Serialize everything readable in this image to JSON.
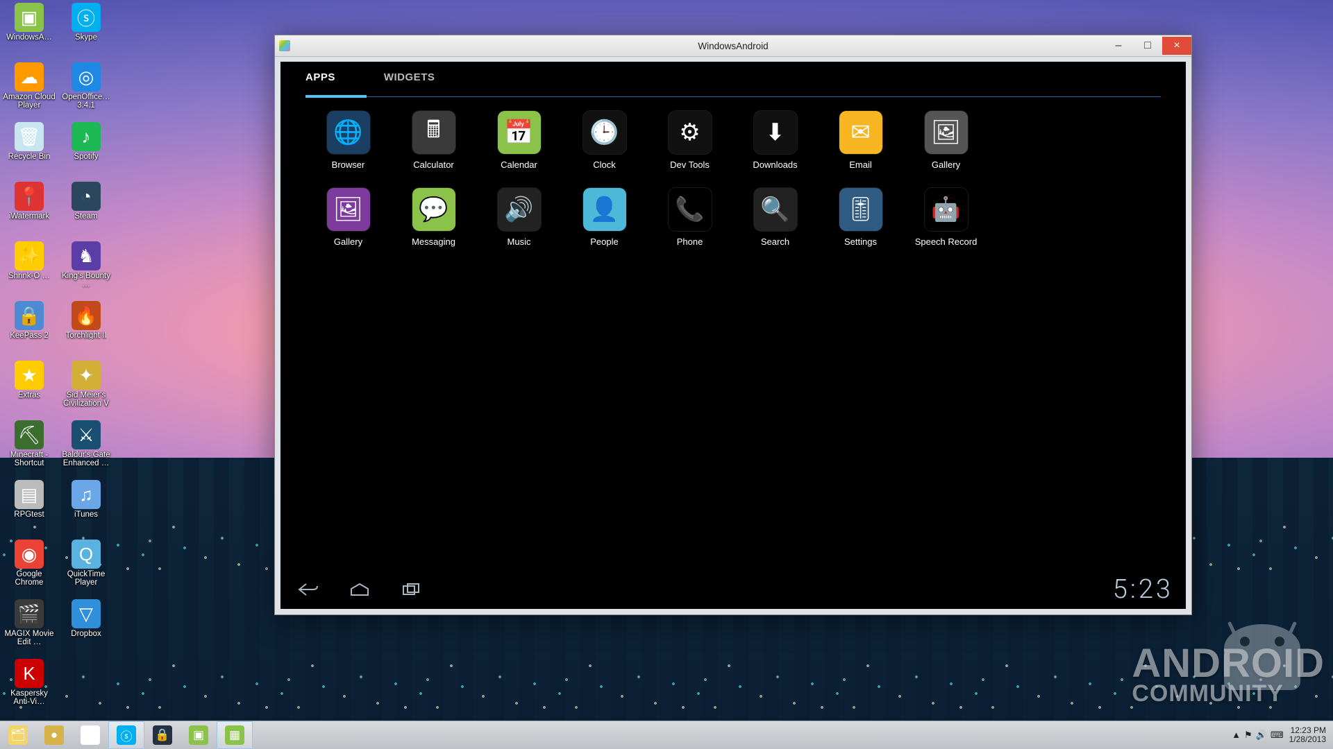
{
  "window": {
    "title": "WindowsAndroid",
    "minimize": "–",
    "maximize": "□",
    "close": "×"
  },
  "tabs": {
    "apps": "APPS",
    "widgets": "WIDGETS"
  },
  "apps": [
    {
      "label": "Browser",
      "icon": "browser-icon",
      "ibg": "#1b3f63",
      "glyph": "🌐"
    },
    {
      "label": "Calculator",
      "icon": "calculator-icon",
      "ibg": "#3a3a3a",
      "glyph": "🖩"
    },
    {
      "label": "Calendar",
      "icon": "calendar-icon",
      "ibg": "#8bc34a",
      "glyph": "📅"
    },
    {
      "label": "Clock",
      "icon": "clock-icon",
      "ibg": "#111",
      "glyph": "🕒"
    },
    {
      "label": "Dev Tools",
      "icon": "devtools-icon",
      "ibg": "#111",
      "glyph": "⚙"
    },
    {
      "label": "Downloads",
      "icon": "downloads-icon",
      "ibg": "#111",
      "glyph": "⬇"
    },
    {
      "label": "Email",
      "icon": "email-icon",
      "ibg": "#f7b521",
      "glyph": "✉"
    },
    {
      "label": "Gallery",
      "icon": "gallery-icon",
      "ibg": "#555",
      "glyph": "🖼"
    },
    {
      "label": "Gallery",
      "icon": "gallery2-icon",
      "ibg": "#7d3b9e",
      "glyph": "🖼"
    },
    {
      "label": "Messaging",
      "icon": "messaging-icon",
      "ibg": "#8bc34a",
      "glyph": "💬"
    },
    {
      "label": "Music",
      "icon": "music-icon",
      "ibg": "#222",
      "glyph": "🔊"
    },
    {
      "label": "People",
      "icon": "people-icon",
      "ibg": "#4db8d8",
      "glyph": "👤"
    },
    {
      "label": "Phone",
      "icon": "phone-icon",
      "ibg": "#000",
      "glyph": "📞"
    },
    {
      "label": "Search",
      "icon": "search-icon",
      "ibg": "#222",
      "glyph": "🔍"
    },
    {
      "label": "Settings",
      "icon": "settings-icon",
      "ibg": "#2f5a82",
      "glyph": "🎚"
    },
    {
      "label": "Speech Record",
      "icon": "speech-icon",
      "ibg": "#000",
      "glyph": "🤖"
    }
  ],
  "android_clock": "5:23",
  "desktop_icons": [
    [
      "WindowsA…",
      "windowsandroid-icon",
      "#8bc34a",
      "▣"
    ],
    [
      "Skype",
      "skype-icon",
      "#00aff0",
      "ⓢ"
    ],
    [
      "Amazon Cloud Player",
      "amazon-cloud-icon",
      "#ff9900",
      "☁"
    ],
    [
      "OpenOffice… 3.4.1",
      "openoffice-icon",
      "#1e88e5",
      "◎"
    ],
    [
      "Recycle Bin",
      "recycle-bin-icon",
      "#c8e6f0",
      "🗑"
    ],
    [
      "Spotify",
      "spotify-icon",
      "#1db954",
      "♪"
    ],
    [
      "iWatermark",
      "iwatermark-icon",
      "#d33",
      "📍"
    ],
    [
      "Steam",
      "steam-icon",
      "#2a475e",
      "◔"
    ],
    [
      "Shrink-O …",
      "shrinko-icon",
      "#ffcc00",
      "✨"
    ],
    [
      "King's Bounty …",
      "kings-bounty-icon",
      "#5a3da6",
      "♞"
    ],
    [
      "KeePass 2",
      "keepass-icon",
      "#4e8ad4",
      "🔒"
    ],
    [
      "Torchlight II",
      "torchlight-icon",
      "#c24a1a",
      "🔥"
    ],
    [
      "Extras",
      "extras-icon",
      "#ffcc00",
      "★"
    ],
    [
      "Sid Meier's Civilization V",
      "civ5-icon",
      "#d4af37",
      "✦"
    ],
    [
      "Minecraft - Shortcut",
      "minecraft-icon",
      "#3b6e2e",
      "⛏"
    ],
    [
      "Baldur's Gate Enhanced …",
      "baldurs-gate-icon",
      "#1b4f72",
      "⚔"
    ],
    [
      "RPGtest",
      "rpgtest-icon",
      "#bbb",
      "▤"
    ],
    [
      "iTunes",
      "itunes-icon",
      "#6aa6e8",
      "♫"
    ],
    [
      "Google Chrome",
      "chrome-icon",
      "#ea4335",
      "◉"
    ],
    [
      "QuickTime Player",
      "quicktime-icon",
      "#5ab2e0",
      "Q"
    ],
    [
      "MAGIX Movie Edit …",
      "magix-icon",
      "#3a3a3a",
      "🎬"
    ],
    [
      "Dropbox",
      "dropbox-icon",
      "#2f8fd8",
      "▽"
    ],
    [
      "Kaspersky Anti-Vi…",
      "kaspersky-icon",
      "#cc0000",
      "K"
    ]
  ],
  "taskbar": {
    "items": [
      {
        "name": "explorer",
        "bg": "#f3d46b",
        "glyph": "🗂"
      },
      {
        "name": "unknown-app",
        "bg": "#d6b34a",
        "glyph": "●"
      },
      {
        "name": "chrome",
        "bg": "#fff",
        "glyph": "◉"
      },
      {
        "name": "skype",
        "bg": "#00aff0",
        "glyph": "ⓢ"
      },
      {
        "name": "lock-app",
        "bg": "#233142",
        "glyph": "🔒"
      },
      {
        "name": "android",
        "bg": "#8bc34a",
        "glyph": "▣"
      },
      {
        "name": "windowsandroid",
        "bg": "#8bc34a",
        "glyph": "▦"
      }
    ],
    "time": "12:23 PM",
    "date": "1/28/2013",
    "tray_icons": [
      "▲",
      "⚑",
      "🔊",
      "⌨"
    ]
  },
  "watermark": {
    "line1": "ANDROID",
    "line2": "COMMUNITY"
  }
}
